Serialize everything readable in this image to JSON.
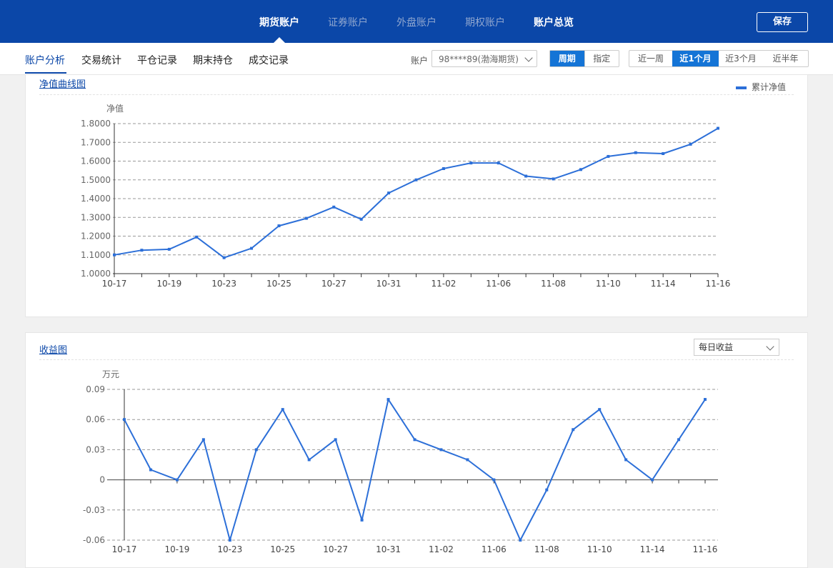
{
  "topnav": {
    "tabs": [
      "期货账户",
      "证券账户",
      "外盘账户",
      "期权账户",
      "账户总览"
    ],
    "save_label": "保存"
  },
  "subnav": {
    "tabs": [
      "账户分析",
      "交易统计",
      "平仓记录",
      "期末持仓",
      "成交记录"
    ],
    "account_label": "账户",
    "account_value": "98****89(渤海期货)",
    "mode_options": [
      "周期",
      "指定"
    ],
    "period_options": [
      "近一周",
      "近1个月",
      "近3个月",
      "近半年"
    ]
  },
  "netvalue_panel": {
    "title": "净值曲线图",
    "legend": "累计净值"
  },
  "profit_panel": {
    "title": "收益图",
    "dropdown_value": "每日收益"
  },
  "colors": {
    "brand": "#0b47a8",
    "accent": "#1474d6",
    "line": "#2c6fd8"
  },
  "icons": {
    "dropdown": "chevron-down-icon",
    "caret": "caret-up-icon"
  },
  "chart_data": [
    {
      "type": "line",
      "title": "",
      "ylabel": "净值",
      "xlabel": "",
      "ylim": [
        1.0,
        1.8
      ],
      "yticks": [
        "1.0000",
        "1.1000",
        "1.2000",
        "1.3000",
        "1.4000",
        "1.5000",
        "1.6000",
        "1.7000",
        "1.8000"
      ],
      "xticks": [
        "10-17",
        "10-19",
        "10-23",
        "10-25",
        "10-27",
        "10-31",
        "11-02",
        "11-06",
        "11-08",
        "11-10",
        "11-14",
        "11-16"
      ],
      "grid": true,
      "legend": "top-right",
      "series": [
        {
          "name": "累计净值",
          "values": [
            1.1,
            1.125,
            1.13,
            1.195,
            1.085,
            1.135,
            1.255,
            1.295,
            1.355,
            1.29,
            1.43,
            1.5,
            1.56,
            1.59,
            1.59,
            1.52,
            1.505,
            1.555,
            1.625,
            1.645,
            1.64,
            1.69,
            1.775
          ]
        }
      ]
    },
    {
      "type": "line",
      "title": "",
      "ylabel": "万元",
      "xlabel": "",
      "ylim": [
        -0.06,
        0.09
      ],
      "yticks": [
        "-0.06",
        "-0.03",
        "0",
        "0.03",
        "0.06",
        "0.09"
      ],
      "xticks": [
        "10-17",
        "10-19",
        "10-23",
        "10-25",
        "10-27",
        "10-31",
        "11-02",
        "11-06",
        "11-08",
        "11-10",
        "11-14",
        "11-16"
      ],
      "grid": true,
      "series": [
        {
          "values": [
            0.06,
            0.01,
            0.0,
            0.04,
            -0.06,
            0.03,
            0.07,
            0.02,
            0.04,
            -0.04,
            0.08,
            0.04,
            0.03,
            0.02,
            0.0,
            -0.06,
            -0.01,
            0.05,
            0.07,
            0.02,
            0.0,
            0.04,
            0.08
          ]
        }
      ]
    }
  ]
}
